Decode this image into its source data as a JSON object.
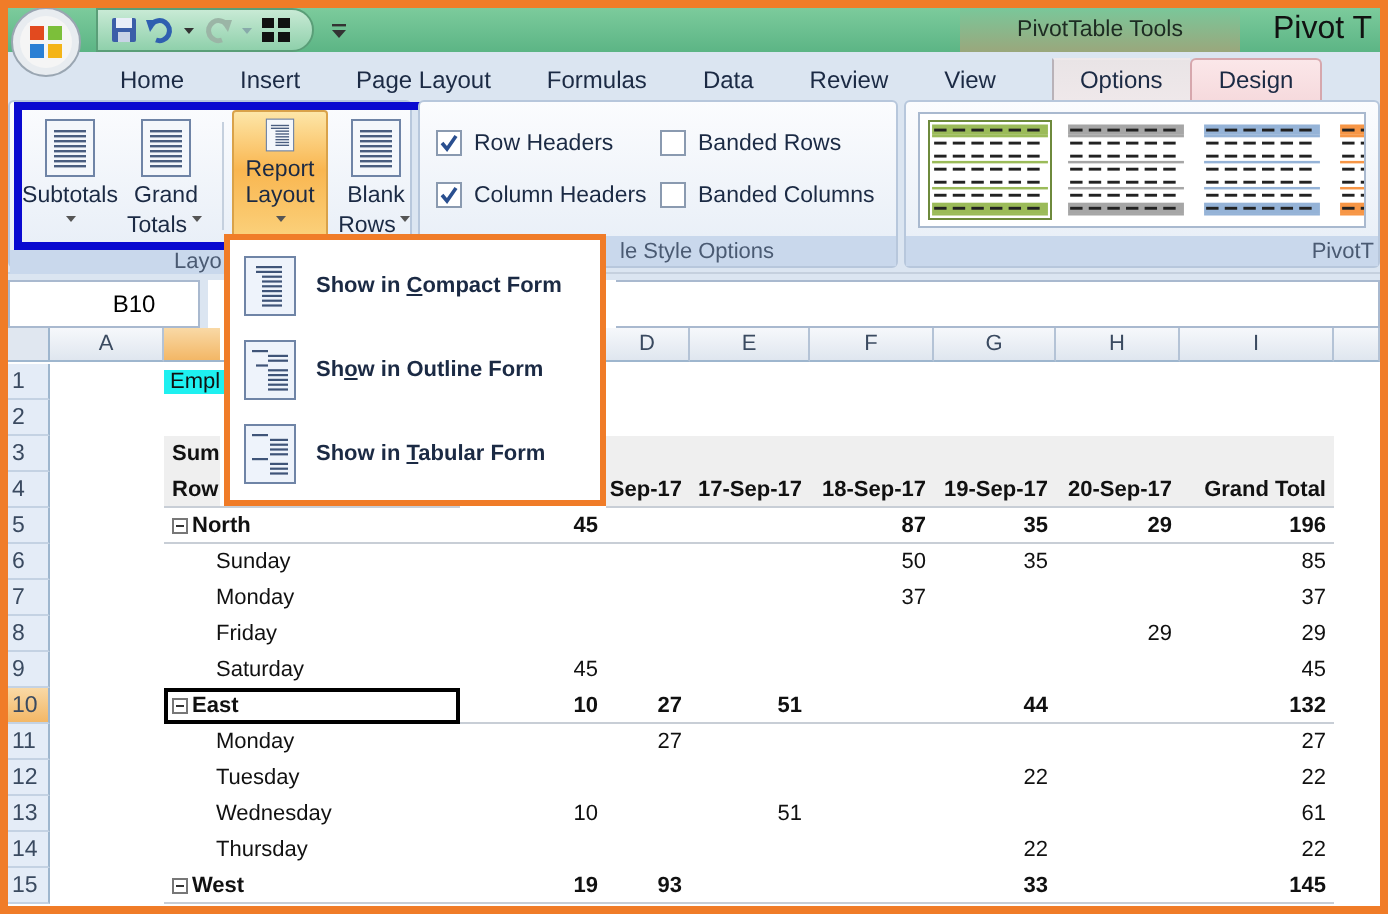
{
  "title_bar": {
    "contextual_label": "PivotTable Tools",
    "title": "Pivot T"
  },
  "tabs": [
    {
      "label": "Home",
      "selected": false,
      "contextual": false
    },
    {
      "label": "Insert",
      "selected": false,
      "contextual": false
    },
    {
      "label": "Page Layout",
      "selected": false,
      "contextual": false
    },
    {
      "label": "Formulas",
      "selected": false,
      "contextual": false
    },
    {
      "label": "Data",
      "selected": false,
      "contextual": false
    },
    {
      "label": "Review",
      "selected": false,
      "contextual": false
    },
    {
      "label": "View",
      "selected": false,
      "contextual": false
    },
    {
      "label": "Options",
      "selected": false,
      "contextual": true
    },
    {
      "label": "Design",
      "selected": true,
      "contextual": true
    }
  ],
  "ribbon": {
    "layout_group": {
      "label": "Layo",
      "highlighted": true,
      "buttons": [
        {
          "lines": [
            "Subtotals"
          ],
          "selected": false
        },
        {
          "lines": [
            "Grand",
            "Totals"
          ],
          "selected": false
        },
        {
          "lines": [
            "Report",
            "Layout"
          ],
          "selected": true
        },
        {
          "lines": [
            "Blank",
            "Rows"
          ],
          "selected": false
        }
      ]
    },
    "options_group": {
      "label": "le Style Options",
      "checkboxes": [
        {
          "label": "Row Headers",
          "checked": true
        },
        {
          "label": "Banded Rows",
          "checked": false
        },
        {
          "label": "Column Headers",
          "checked": true
        },
        {
          "label": "Banded Columns",
          "checked": false
        }
      ]
    },
    "styles_group": {
      "label": "PivotT",
      "styles": [
        {
          "color": "#9bbb59",
          "selected": true
        },
        {
          "color": "#a6a6a6",
          "selected": false
        },
        {
          "color": "#95b3d7",
          "selected": false
        },
        {
          "color": "#f79646",
          "selected": false
        }
      ]
    }
  },
  "formula_bar": {
    "name_box": "B10"
  },
  "sheet": {
    "columns": [
      {
        "label": "A",
        "selected": false
      },
      {
        "selected": true
      },
      {},
      {
        "label": "D",
        "selected": false
      },
      {
        "label": "E",
        "selected": false
      },
      {
        "label": "F",
        "selected": false
      },
      {
        "label": "G",
        "selected": false
      },
      {
        "label": "H",
        "selected": false
      },
      {
        "label": "I",
        "selected": false
      }
    ],
    "rows": [
      {
        "number": "1",
        "selected": false,
        "kind": "title",
        "label": "Empl"
      },
      {
        "number": "2",
        "selected": false,
        "kind": "blank"
      },
      {
        "number": "3",
        "selected": false,
        "kind": "header",
        "label": "Sum"
      },
      {
        "number": "4",
        "selected": false,
        "kind": "header",
        "label": "Row",
        "values": {
          "D": "Sep-17",
          "E": "17-Sep-17",
          "F": "18-Sep-17",
          "G": "19-Sep-17",
          "H": "20-Sep-17",
          "I": "Grand Total"
        }
      },
      {
        "number": "5",
        "selected": false,
        "kind": "group",
        "label": "North",
        "expanded": true,
        "values": {
          "C": "45",
          "F": "87",
          "G": "35",
          "H": "29",
          "I": "196"
        }
      },
      {
        "number": "6",
        "selected": false,
        "kind": "item",
        "label": "Sunday",
        "values": {
          "F": "50",
          "G": "35",
          "I": "85"
        }
      },
      {
        "number": "7",
        "selected": false,
        "kind": "item",
        "label": "Monday",
        "values": {
          "F": "37",
          "I": "37"
        }
      },
      {
        "number": "8",
        "selected": false,
        "kind": "item",
        "label": "Friday",
        "values": {
          "H": "29",
          "I": "29"
        }
      },
      {
        "number": "9",
        "selected": false,
        "kind": "item",
        "label": "Saturday",
        "values": {
          "C": "45",
          "I": "45"
        }
      },
      {
        "number": "10",
        "selected": true,
        "kind": "group",
        "label": "East",
        "expanded": true,
        "values": {
          "C": "10",
          "D": "27",
          "E": "51",
          "G": "44",
          "I": "132"
        }
      },
      {
        "number": "11",
        "selected": false,
        "kind": "item",
        "label": "Monday",
        "values": {
          "D": "27",
          "I": "27"
        }
      },
      {
        "number": "12",
        "selected": false,
        "kind": "item",
        "label": "Tuesday",
        "values": {
          "G": "22",
          "I": "22"
        }
      },
      {
        "number": "13",
        "selected": false,
        "kind": "item",
        "label": "Wednesday",
        "values": {
          "C": "10",
          "E": "51",
          "I": "61"
        }
      },
      {
        "number": "14",
        "selected": false,
        "kind": "item",
        "label": "Thursday",
        "values": {
          "G": "22",
          "I": "22"
        }
      },
      {
        "number": "15",
        "selected": false,
        "kind": "group",
        "label": "West",
        "expanded": true,
        "values": {
          "C": "19",
          "D": "93",
          "G": "33",
          "I": "145"
        }
      }
    ]
  },
  "menu": {
    "items": [
      {
        "kind": "compact",
        "parts": [
          "Show in ",
          "C",
          "ompact Form"
        ]
      },
      {
        "kind": "outline",
        "parts": [
          "Sh",
          "o",
          "w in Outline Form"
        ]
      },
      {
        "kind": "tabular",
        "parts": [
          "Show in ",
          "T",
          "abular Form"
        ]
      }
    ]
  }
}
